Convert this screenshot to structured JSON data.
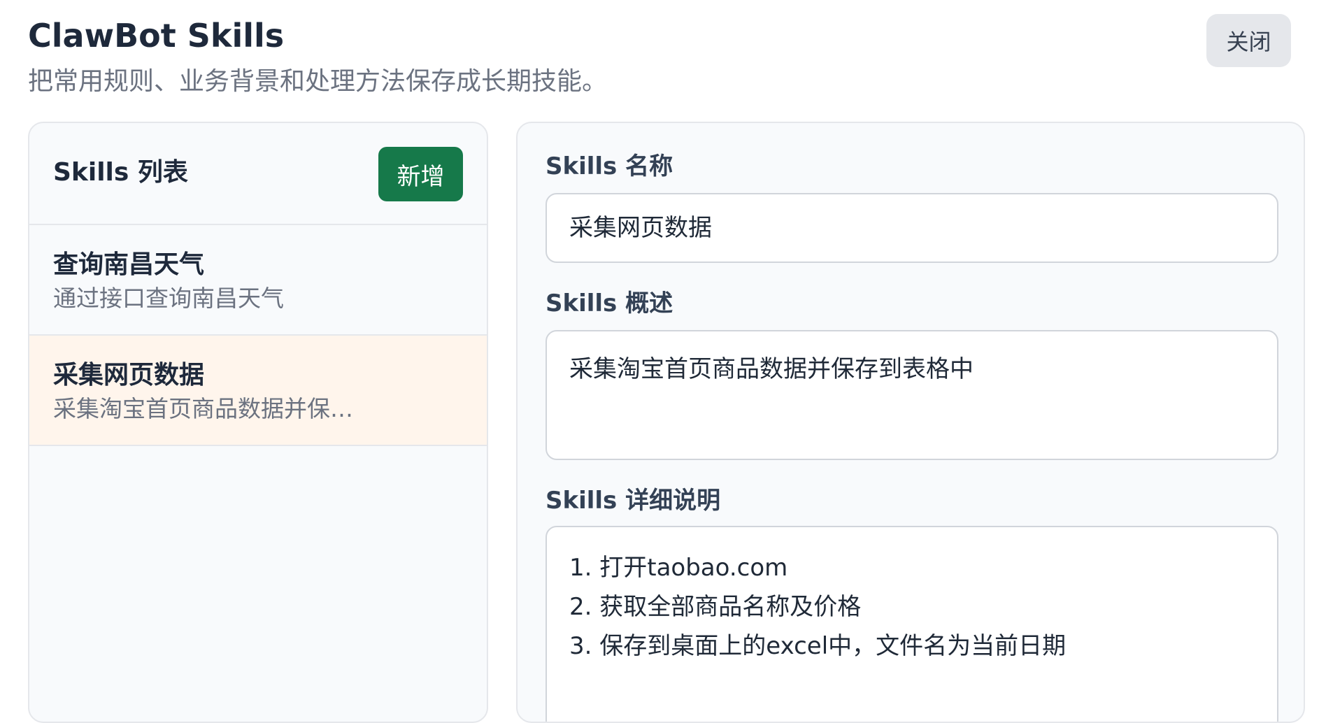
{
  "header": {
    "title": "ClawBot Skills",
    "subtitle": "把常用规则、业务背景和处理方法保存成长期技能。",
    "close_label": "关闭"
  },
  "list": {
    "title": "Skills 列表",
    "add_label": "新增",
    "items": [
      {
        "name": "查询南昌天气",
        "desc": "通过接口查询南昌天气"
      },
      {
        "name": "采集网页数据",
        "desc": "采集淘宝首页商品数据并保存..."
      }
    ]
  },
  "editor": {
    "name_label": "Skills 名称",
    "name_value": "采集网页数据",
    "summary_label": "Skills 概述",
    "summary_value": "采集淘宝首页商品数据并保存到表格中",
    "detail_label": "Skills 详细说明",
    "detail_lines": [
      "1. 打开taobao.com",
      "2. 获取全部商品名称及价格",
      "3. 保存到桌面上的excel中，文件名为当前日期"
    ]
  },
  "colors": {
    "accent": "#16794a",
    "selected_item_bg": "#fff5ec",
    "panel_bg": "#f8fafc",
    "border": "#e5e7eb"
  }
}
